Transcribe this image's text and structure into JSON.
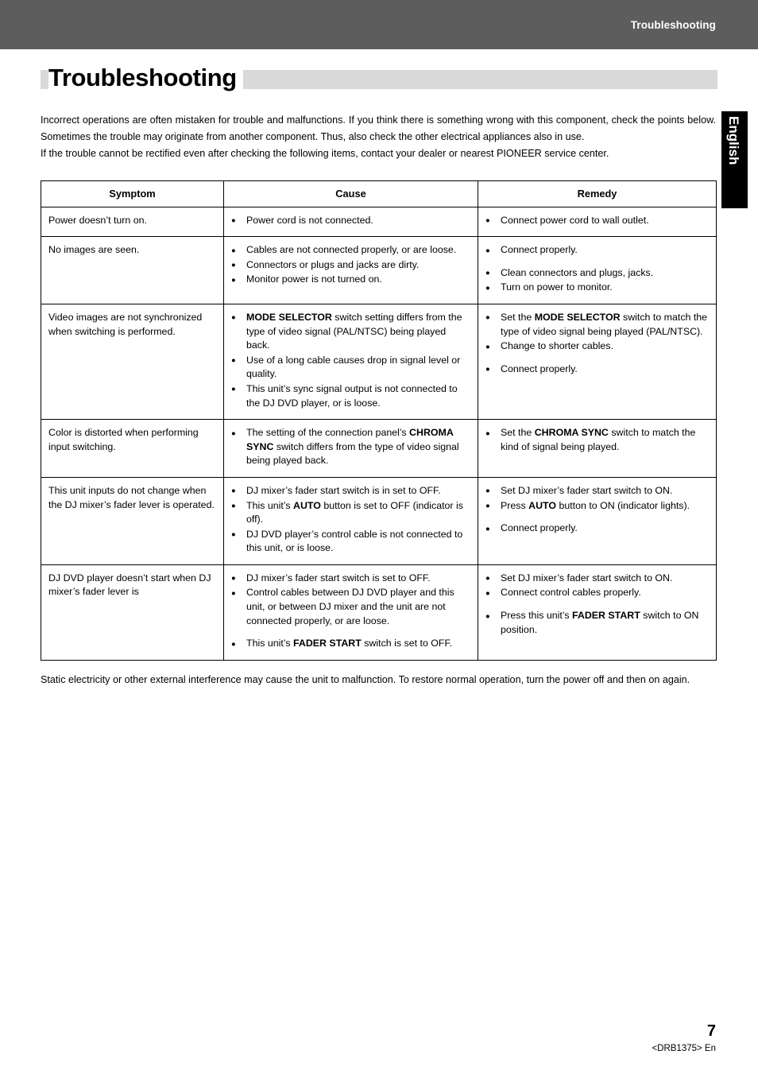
{
  "header": {
    "title": "Troubleshooting"
  },
  "page": {
    "title": "Troubleshooting",
    "side_tab": "English",
    "intro_1": "Incorrect operations are often mistaken for trouble and malfunctions. If you think there is something wrong with this component, check the points below. Sometimes the trouble may originate from another component. Thus, also check the other electrical appliances also in use.",
    "intro_2": "If the trouble cannot be rectified even after checking the following items, contact your dealer or nearest PIONEER service center.",
    "footnote": "Static electricity or other external interference may cause the unit to malfunction. To restore normal operation, turn the power off and then on again.",
    "page_number": "7",
    "page_code": "<DRB1375> En"
  },
  "table": {
    "headers": [
      "Symptom",
      "Cause",
      "Remedy"
    ],
    "rows": [
      {
        "symptom": "Power doesn’t turn on.",
        "causes": [
          "Power cord is not connected."
        ],
        "remedies": [
          "Connect power cord to wall outlet."
        ]
      },
      {
        "symptom": "No images are seen.",
        "causes": [
          "Cables are not connected properly, or are loose.",
          "Connectors or plugs and jacks are dirty.",
          "Monitor power is not turned on."
        ],
        "remedies": [
          "Connect properly.",
          "Clean connectors and plugs, jacks.",
          "Turn on power to monitor."
        ]
      },
      {
        "symptom": "Video images are not synchronized when switching is performed.",
        "causes_html": [
          "<b>MODE SELECTOR</b> switch setting differs from the type of video signal (PAL/NTSC) being played back.",
          "Use of a long cable causes drop in signal level or quality.",
          "This unit’s sync signal output is not connected to the DJ DVD player, or is loose."
        ],
        "remedies_html": [
          "Set the <b>MODE SELECTOR</b> switch to match the type of video signal being played (PAL/NTSC).",
          "Change to shorter cables.",
          "Connect properly."
        ]
      },
      {
        "symptom": "Color is distorted when performing input switching.",
        "causes_html": [
          "The setting of the connection panel’s <b>CHROMA SYNC</b> switch differs from the type of video signal being played back."
        ],
        "remedies_html": [
          "Set the <b>CHROMA SYNC</b> switch to match the kind of signal being played."
        ]
      },
      {
        "symptom": "This unit inputs do not change when the DJ mixer’s fader lever is operated.",
        "causes_html": [
          "DJ mixer’s fader start switch is in set to OFF.",
          "This unit’s <b>AUTO</b> button is set to OFF (indicator is off).",
          "DJ DVD player’s control cable is not connected to this unit, or is loose."
        ],
        "remedies_html": [
          "Set DJ mixer’s fader start switch to ON.",
          "Press <b>AUTO</b> button to ON (indicator lights).",
          "Connect properly."
        ]
      },
      {
        "symptom": "DJ DVD player doesn’t start when DJ mixer’s fader lever is",
        "causes_html": [
          "DJ mixer’s fader start switch is set to OFF.",
          "Control cables between DJ DVD player and this unit, or between DJ mixer and the unit are not connected properly, or are loose.",
          "This unit’s <b>FADER START</b> switch is set to OFF."
        ],
        "remedies_html": [
          "Set DJ mixer’s fader start switch to ON.",
          "Connect control cables properly.",
          "Press this unit’s <b>FADER START</b> switch to ON position."
        ]
      }
    ]
  }
}
